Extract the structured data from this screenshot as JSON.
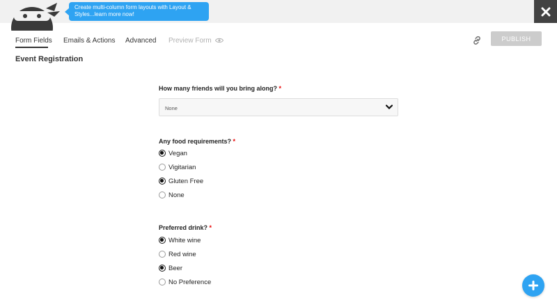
{
  "tooltip": {
    "text": "Create multi-column form layouts with Layout & Styles...learn more now!"
  },
  "tabs": [
    {
      "label": "Form Fields",
      "active": true
    },
    {
      "label": "Emails & Actions"
    },
    {
      "label": "Advanced"
    },
    {
      "label": "Preview Form",
      "disabled": true
    }
  ],
  "header": {
    "publish_label": "PUBLISH"
  },
  "form": {
    "title": "Event Registration",
    "friends": {
      "label": "How many friends will you bring along?",
      "required_mark": "*",
      "selected": "None"
    },
    "food": {
      "label": "Any food requirements?",
      "required_mark": "*",
      "options": [
        {
          "label": "Vegan",
          "checked": true
        },
        {
          "label": "Vigitarian",
          "checked": false
        },
        {
          "label": "Gluten Free",
          "checked": true
        },
        {
          "label": "None",
          "checked": false
        }
      ]
    },
    "drink": {
      "label": "Preferred drink?",
      "required_mark": "*",
      "options": [
        {
          "label": "White wine",
          "checked": true
        },
        {
          "label": "Red wine",
          "checked": false
        },
        {
          "label": "Beer",
          "checked": true
        },
        {
          "label": "No Preference",
          "checked": false
        }
      ]
    }
  },
  "icons": {
    "close": "close-icon",
    "link": "link-icon",
    "eye": "eye-icon",
    "chevron": "chevron-down-icon",
    "add": "plus-icon",
    "logo": "ninja-logo"
  },
  "colors": {
    "accent": "#2ea3f2",
    "close_bg": "#424242",
    "publish_bg": "#cccccc",
    "required": "#e80000"
  }
}
